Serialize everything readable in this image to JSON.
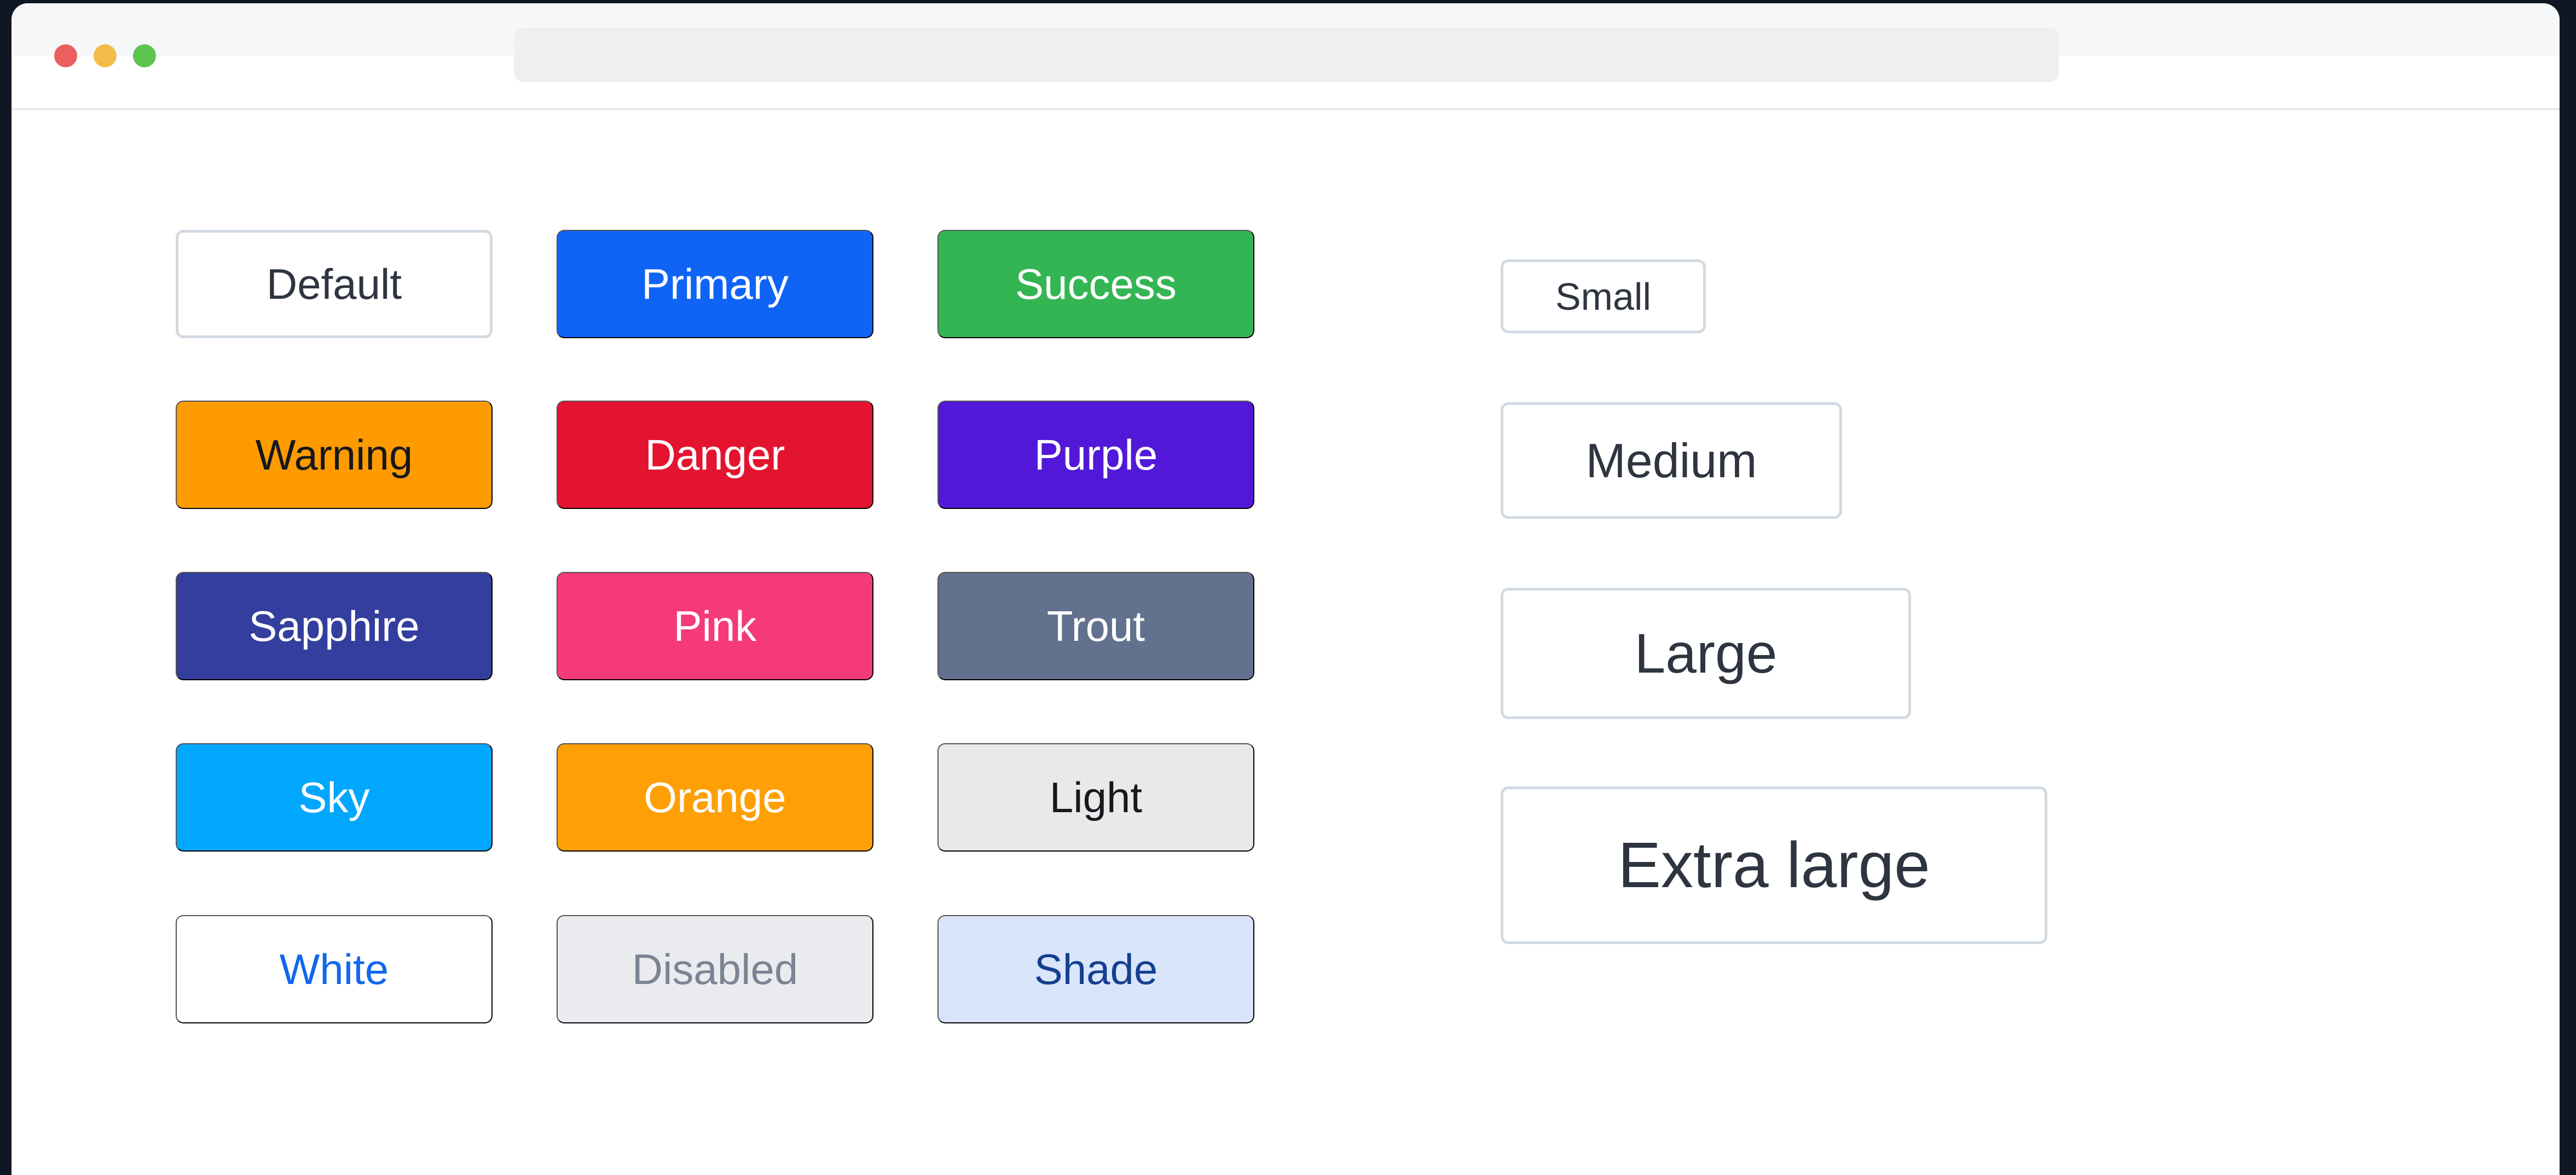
{
  "window": {
    "address_bar_value": ""
  },
  "button_grid": {
    "rows": [
      [
        {
          "label": "Default",
          "variant": "default",
          "background": "#ffffff",
          "text_color": "#2e3440"
        },
        {
          "label": "Primary",
          "variant": "primary",
          "background": "#0f64f6",
          "text_color": "#ffffff"
        },
        {
          "label": "Success",
          "variant": "success",
          "background": "#34b553",
          "text_color": "#ffffff"
        }
      ],
      [
        {
          "label": "Warning",
          "variant": "warning",
          "background": "#fe9b01",
          "text_color": "#15181d"
        },
        {
          "label": "Danger",
          "variant": "danger",
          "background": "#e41430",
          "text_color": "#ffffff"
        },
        {
          "label": "Purple",
          "variant": "purple",
          "background": "#5218d8",
          "text_color": "#ffffff"
        }
      ],
      [
        {
          "label": "Sapphire",
          "variant": "sapphire",
          "background": "#333e9e",
          "text_color": "#ffffff"
        },
        {
          "label": "Pink",
          "variant": "pink",
          "background": "#f43a79",
          "text_color": "#ffffff"
        },
        {
          "label": "Trout",
          "variant": "trout",
          "background": "#62718d",
          "text_color": "#ffffff"
        }
      ],
      [
        {
          "label": "Sky",
          "variant": "sky",
          "background": "#01a7fd",
          "text_color": "#ffffff"
        },
        {
          "label": "Orange",
          "variant": "orange",
          "background": "#fe9f05",
          "text_color": "#ffffff"
        },
        {
          "label": "Light",
          "variant": "light",
          "background": "#e9e9e9",
          "text_color": "#15181d"
        }
      ],
      [
        {
          "label": "White",
          "variant": "white",
          "background": "#ffffff",
          "text_color": "#1167ee"
        },
        {
          "label": "Disabled",
          "variant": "disabled",
          "background": "#eaebee",
          "text_color": "#7b8494",
          "disabled": true
        },
        {
          "label": "Shade",
          "variant": "shade",
          "background": "#d9e5fb",
          "text_color": "#153f8f"
        }
      ]
    ]
  },
  "size_buttons": [
    {
      "label": "Small",
      "size": "small"
    },
    {
      "label": "Medium",
      "size": "medium"
    },
    {
      "label": "Large",
      "size": "large"
    },
    {
      "label": "Extra large",
      "size": "extra-large"
    }
  ],
  "colors": {
    "page_background": "#0f1724",
    "window_background": "#ffffff",
    "border_gray": "#d2d9e1",
    "traffic_light_red": "#ec5f5f",
    "traffic_light_yellow": "#f3bc4a",
    "traffic_light_green": "#5dc44e"
  }
}
